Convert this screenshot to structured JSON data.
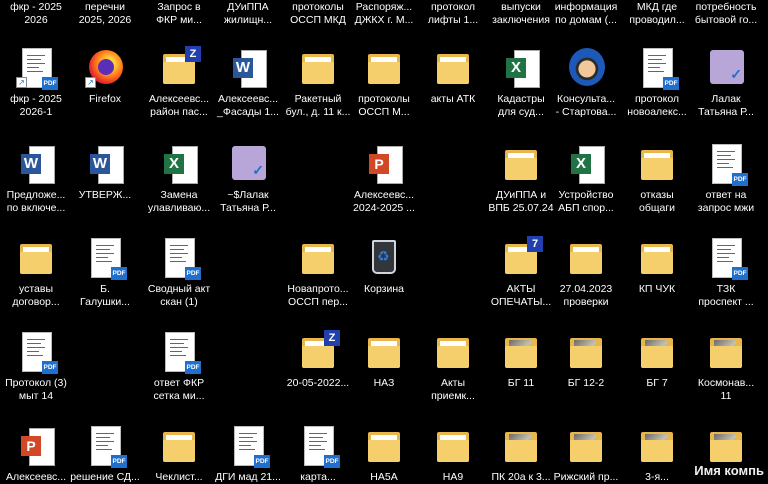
{
  "top_row": [
    {
      "label": "фкр - 2025\n2026"
    },
    {
      "label": "перечни\n2025, 2026"
    },
    {
      "label": "Запрос в\nФКР ми..."
    },
    {
      "label": "ДУиППА\nжилищн..."
    },
    {
      "label": "протоколы\nОССП МКД"
    },
    {
      "label": "Распоряж...\nДЖКХ г. М..."
    },
    {
      "label": "протокол\nлифты 1..."
    },
    {
      "label": "выпуски\nзаключения"
    },
    {
      "label": "информация\nпо домам (..."
    },
    {
      "label": "МКД где\nпроводил..."
    },
    {
      "label": "потребность\nбытовой го..."
    }
  ],
  "icons": [
    {
      "id": "r1c1",
      "type": "pdf",
      "label": "фкр - 2025\n2026-1",
      "shortcut": true
    },
    {
      "id": "r1c2",
      "type": "firefox",
      "label": "Firefox",
      "shortcut": true
    },
    {
      "id": "r1c3",
      "type": "folder-z",
      "label": "Алексеевс...\nрайон пас..."
    },
    {
      "id": "r1c4",
      "type": "word",
      "label": "Алексеевс...\n_Фасады 1..."
    },
    {
      "id": "r1c5",
      "type": "folder",
      "label": "Ракетный\nбул., д. 11 к..."
    },
    {
      "id": "r1c6",
      "type": "folder",
      "label": "протоколы\nОССП М..."
    },
    {
      "id": "r1c7",
      "type": "folder",
      "label": "акты АТК"
    },
    {
      "id": "r1c8",
      "type": "excel",
      "label": "Кадастры\nдля суд..."
    },
    {
      "id": "r1c9",
      "type": "prof",
      "label": "Консульта...\n- Стартова..."
    },
    {
      "id": "r1c10",
      "type": "pdf",
      "label": "протокол\nновоалекс..."
    },
    {
      "id": "r1c11",
      "type": "app",
      "label": "Лалак\nТатьяна Р..."
    },
    {
      "id": "r2c1",
      "type": "word",
      "label": "Предложе...\nпо включе..."
    },
    {
      "id": "r2c2",
      "type": "word",
      "label": "УТВЕРЖ..."
    },
    {
      "id": "r2c3",
      "type": "excel",
      "label": "Замена\nулавливаю..."
    },
    {
      "id": "r2c4",
      "type": "app",
      "label": "~$Лалак\nТатьяна Р..."
    },
    {
      "id": "r2c6",
      "type": "ppt",
      "label": "Алексеевс...\n2024-2025 ..."
    },
    {
      "id": "r2c8",
      "type": "folder",
      "label": "ДУиППА и\nВПБ 25.07.24"
    },
    {
      "id": "r2c9",
      "type": "excel",
      "label": "Устройство\nАБП спор..."
    },
    {
      "id": "r2c10",
      "type": "folder",
      "label": "отказы\nобщаги"
    },
    {
      "id": "r2c11",
      "type": "pdf",
      "label": "ответ на\nзапрос мжи"
    },
    {
      "id": "r3c1",
      "type": "folder",
      "label": "уставы\nдоговор..."
    },
    {
      "id": "r3c2",
      "type": "pdf",
      "label": "Б.\nГалушки..."
    },
    {
      "id": "r3c3",
      "type": "pdf",
      "label": "Сводный акт\nскан (1)"
    },
    {
      "id": "r3c5",
      "type": "folder",
      "label": "Новапрото...\nОССП пер..."
    },
    {
      "id": "r3c6",
      "type": "bin",
      "label": "Корзина"
    },
    {
      "id": "r3c8",
      "type": "folder-7",
      "label": "АКТЫ\nОПЕЧАТЫ..."
    },
    {
      "id": "r3c9",
      "type": "folder",
      "label": "27.04.2023\nпроверки"
    },
    {
      "id": "r3c10",
      "type": "folder",
      "label": "КП ЧУК"
    },
    {
      "id": "r3c11",
      "type": "pdf",
      "label": "ТЗК\nпроспект ..."
    },
    {
      "id": "r4c1",
      "type": "pdf",
      "label": "Протокол (3)\nмыт 14"
    },
    {
      "id": "r4c3",
      "type": "pdf",
      "label": "ответ ФКР\nсетка ми..."
    },
    {
      "id": "r4c5",
      "type": "folder-z",
      "label": "20-05-2022..."
    },
    {
      "id": "r4c6",
      "type": "folder",
      "label": "НАЗ"
    },
    {
      "id": "r4c7",
      "type": "folder",
      "label": "Акты\nприемк..."
    },
    {
      "id": "r4c8",
      "type": "folder-photo",
      "label": "БГ 11"
    },
    {
      "id": "r4c9",
      "type": "folder-photo",
      "label": "БГ 12-2"
    },
    {
      "id": "r4c10",
      "type": "folder-photo",
      "label": "БГ 7"
    },
    {
      "id": "r4c11",
      "type": "folder-photo",
      "label": "Космонав...\n11"
    },
    {
      "id": "r5c1",
      "type": "ppt",
      "label": "Алексеевс..."
    },
    {
      "id": "r5c2",
      "type": "pdf",
      "label": "решение СД..."
    },
    {
      "id": "r5c3",
      "type": "folder",
      "label": "Чеклист..."
    },
    {
      "id": "r5c4",
      "type": "pdf",
      "label": "ДГИ мад 21..."
    },
    {
      "id": "r5c5",
      "type": "pdf",
      "label": "карта..."
    },
    {
      "id": "r5c6",
      "type": "folder",
      "label": "НА5А"
    },
    {
      "id": "r5c7",
      "type": "folder",
      "label": "НА9"
    },
    {
      "id": "r5c8",
      "type": "folder-photo",
      "label": "ПК 20а к 3..."
    },
    {
      "id": "r5c9",
      "type": "folder-photo",
      "label": "Рижский пр..."
    },
    {
      "id": "r5c10",
      "type": "folder-photo",
      "label": "3-я..."
    },
    {
      "id": "r5c11",
      "type": "folder-photo",
      "label": ""
    }
  ],
  "watermark": "Имя компь",
  "colors": {
    "background": "#000000",
    "folder": "#f5cf6b",
    "word": "#2b579a",
    "excel": "#217346",
    "ppt": "#d24726",
    "pdf_badge": "#1f6fcf"
  }
}
